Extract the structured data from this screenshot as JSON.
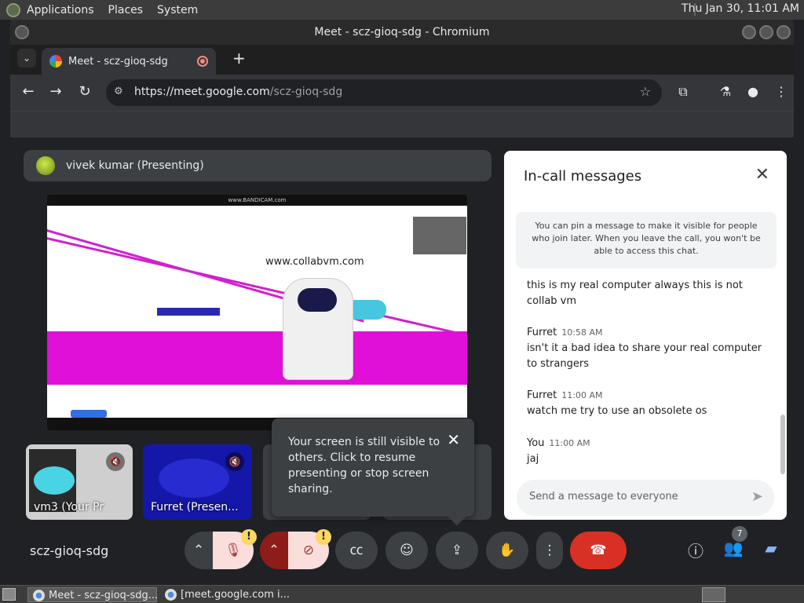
{
  "top_panel": {
    "menus": [
      "Applications",
      "Places",
      "System"
    ],
    "clock": "Thu Jan 30, 11:01 AM"
  },
  "window": {
    "title": "Meet - scz-gioq-sdg - Chromium"
  },
  "browser": {
    "tab_label": "Meet - scz-gioq-sdg",
    "new_tab": "+",
    "url_host": "https://meet.google.com",
    "url_path": "/scz-gioq-sdg"
  },
  "meet": {
    "presenter_label": "vivek kumar (Presenting)",
    "shared_screen": {
      "watermark": "www.collabvm.com",
      "top_text": "www.BANDICAM.com"
    },
    "thumbnails": [
      {
        "name": "vm3 (Your Pr"
      },
      {
        "name": "Furret (Presen..."
      },
      {
        "name": ""
      },
      {
        "name": ""
      }
    ],
    "tooltip": {
      "text": "Your screen is still visible to others. Click to resume presenting or stop screen sharing."
    },
    "meeting_code": "scz-gioq-sdg",
    "warn_badge": "!",
    "participant_count": "7"
  },
  "chat": {
    "title": "In-call messages",
    "info": "You can pin a message to make it visible for people who join later. When you leave the call, you won't be able to access this chat.",
    "messages": [
      {
        "sender": "",
        "time": "",
        "text": "this is my real computer always this is not collab vm"
      },
      {
        "sender": "Furret",
        "time": "10:58 AM",
        "text": "isn't it a bad idea to share your real computer to strangers"
      },
      {
        "sender": "Furret",
        "time": "11:00 AM",
        "text": "watch me try to use an obsolete os"
      },
      {
        "sender": "You",
        "time": "11:00 AM",
        "text": "jaj"
      }
    ],
    "compose_placeholder": "Send a message to everyone"
  },
  "taskbar": {
    "items": [
      "Meet - scz-gioq-sdg...",
      "[meet.google.com i..."
    ]
  },
  "colors": {
    "accent_blue": "#8ab4f8",
    "hangup_red": "#d93025",
    "warning_yellow": "#fdd663"
  }
}
